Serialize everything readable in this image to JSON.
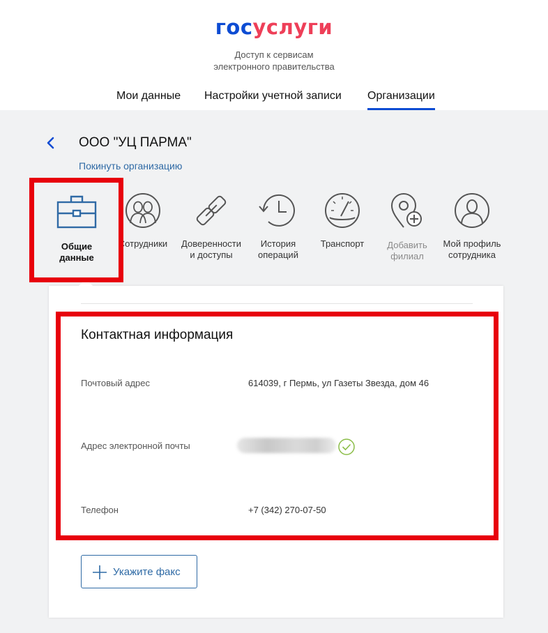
{
  "header": {
    "logo_part1": "гос",
    "logo_part2": "услуги",
    "subtitle_line1": "Доступ к сервисам",
    "subtitle_line2": "электронного правительства",
    "logo_colors": {
      "blue": "#0d4cd3",
      "red": "#ee3f58"
    }
  },
  "nav": {
    "tabs": [
      {
        "label": "Мои данные",
        "active": false
      },
      {
        "label": "Настройки учетной записи",
        "active": false
      },
      {
        "label": "Организации",
        "active": true
      }
    ],
    "accent": "#0d4cd3"
  },
  "org": {
    "name": "ООО \"УЦ ПАРМА\"",
    "leave_link": "Покинуть организацию"
  },
  "sections": [
    {
      "label_line1": "Общие",
      "label_line2": "данные",
      "icon": "briefcase-icon",
      "active": true
    },
    {
      "label_line1": "Сотрудники",
      "label_line2": "",
      "icon": "employees-icon",
      "active": false
    },
    {
      "label_line1": "Доверенности",
      "label_line2": "и доступы",
      "icon": "chain-link-icon",
      "active": false
    },
    {
      "label_line1": "История",
      "label_line2": "операций",
      "icon": "history-icon",
      "active": false
    },
    {
      "label_line1": "Транспорт",
      "label_line2": "",
      "icon": "speedometer-icon",
      "active": false
    },
    {
      "label_line1": "Добавить",
      "label_line2": "филиал",
      "icon": "location-add-icon",
      "active": false,
      "disabled": true
    },
    {
      "label_line1": "Мой профиль",
      "label_line2": "сотрудника",
      "icon": "profile-icon",
      "active": false
    }
  ],
  "contact": {
    "title": "Контактная информация",
    "postal_label": "Почтовый адрес",
    "postal_value": "614039, г Пермь, ул Газеты Звезда, дом 46",
    "email_label": "Адрес электронной почты",
    "email_verified_icon": "check-circle-icon",
    "phone_label": "Телефон",
    "phone_value": "+7 (342) 270-07-50"
  },
  "fax_button": {
    "label": "Укажите факс",
    "icon": "plus-icon"
  },
  "highlight_color": "#e8000b"
}
